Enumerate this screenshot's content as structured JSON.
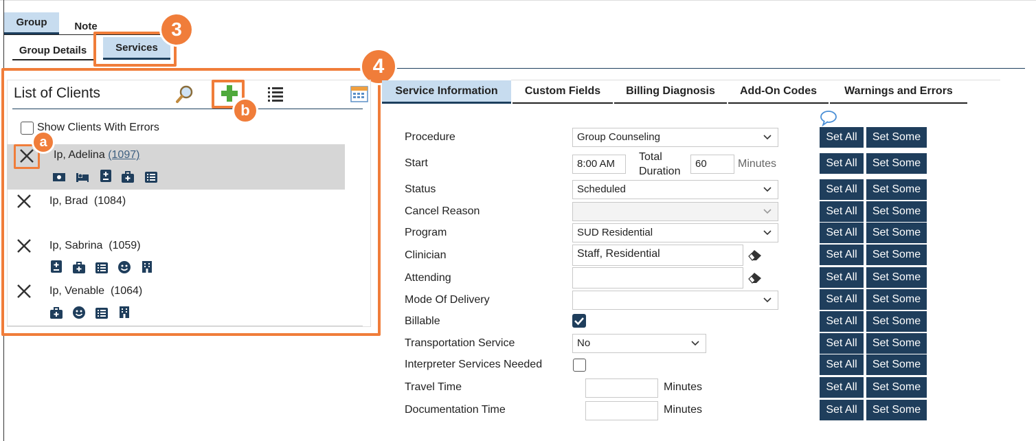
{
  "tabs": {
    "top": [
      "Group",
      "Note"
    ],
    "sub": [
      "Group Details",
      "Services"
    ]
  },
  "annotations": {
    "three": "3",
    "four": "4",
    "a": "a",
    "b": "b"
  },
  "client_list": {
    "title": "List of Clients",
    "show_errors_label": "Show Clients With Errors",
    "clients": [
      {
        "name": "Ip, Adelina",
        "id": "(1097)"
      },
      {
        "name": "Ip, Brad",
        "id": "(1084)"
      },
      {
        "name": "Ip, Sabrina",
        "id": "(1059)"
      },
      {
        "name": "Ip, Venable",
        "id": "(1064)"
      }
    ]
  },
  "service_tabs": [
    "Service Information",
    "Custom Fields",
    "Billing Diagnosis",
    "Add-On Codes",
    "Warnings and Errors"
  ],
  "form": {
    "procedure": {
      "label": "Procedure",
      "value": "Group Counseling"
    },
    "start": {
      "label": "Start",
      "value": "8:00 AM",
      "total_label_1": "Total",
      "total_label_2": "Duration",
      "duration": "60",
      "unit": "Minutes"
    },
    "status": {
      "label": "Status",
      "value": "Scheduled"
    },
    "cancel_reason": {
      "label": "Cancel Reason",
      "value": ""
    },
    "program": {
      "label": "Program",
      "value": "SUD Residential"
    },
    "clinician": {
      "label": "Clinician",
      "value": "Staff, Residential"
    },
    "attending": {
      "label": "Attending",
      "value": ""
    },
    "mode": {
      "label": "Mode Of Delivery",
      "value": ""
    },
    "billable": {
      "label": "Billable",
      "checked": true
    },
    "transport": {
      "label": "Transportation Service",
      "value": "No"
    },
    "interpreter": {
      "label": "Interpreter Services Needed",
      "checked": false
    },
    "travel": {
      "label": "Travel Time",
      "value": "",
      "unit": "Minutes"
    },
    "documentation": {
      "label": "Documentation Time",
      "value": "",
      "unit": "Minutes"
    }
  },
  "buttons": {
    "set_all": "Set All",
    "set_some": "Set Some"
  },
  "colors": {
    "accent": "#f07d3a",
    "navy": "#1f3e5c",
    "tab_active": "#c7dcef"
  }
}
